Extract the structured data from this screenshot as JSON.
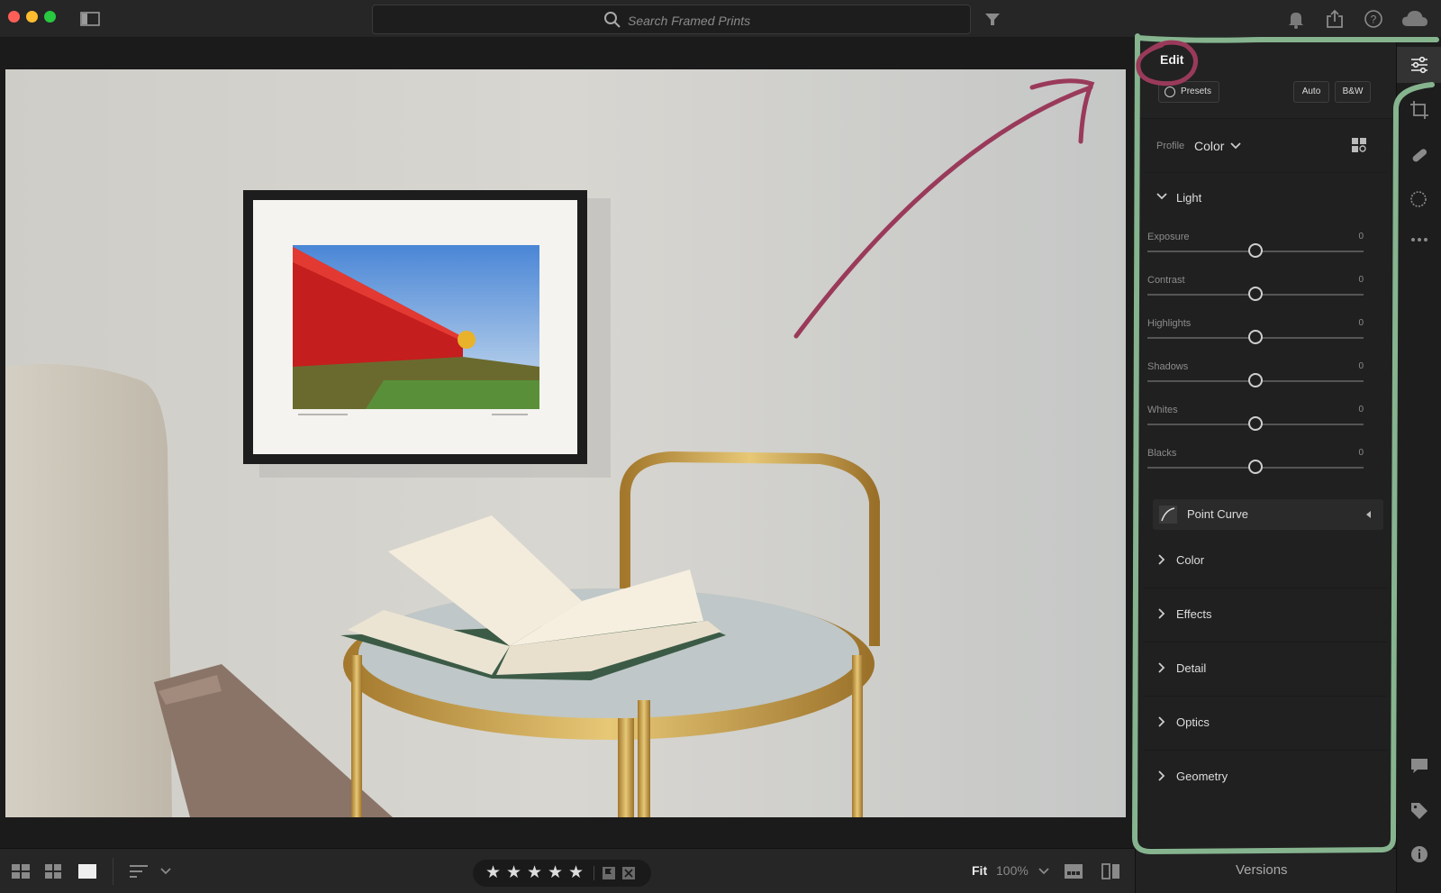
{
  "titlebar": {
    "search_placeholder": "Search Framed Prints",
    "icons": [
      "sidebar-toggle-icon",
      "search-icon",
      "filter-icon",
      "bell-icon",
      "share-icon",
      "help-icon",
      "cloud-icon"
    ]
  },
  "edit_panel": {
    "title": "Edit",
    "presets_label": "Presets",
    "auto_label": "Auto",
    "bw_label": "B&W",
    "profile_label": "Profile",
    "profile_value": "Color",
    "light_section": "Light",
    "sliders": [
      {
        "label": "Exposure",
        "value": "0"
      },
      {
        "label": "Contrast",
        "value": "0"
      },
      {
        "label": "Highlights",
        "value": "0"
      },
      {
        "label": "Shadows",
        "value": "0"
      },
      {
        "label": "Whites",
        "value": "0"
      },
      {
        "label": "Blacks",
        "value": "0"
      }
    ],
    "point_curve_label": "Point Curve",
    "sections": [
      "Color",
      "Effects",
      "Detail",
      "Optics",
      "Geometry"
    ]
  },
  "bottombar": {
    "rating_stars": 5,
    "zoom_fit": "Fit",
    "zoom_percent": "100%",
    "versions_label": "Versions"
  },
  "colors": {
    "annotation_circle": "#9a3a5a",
    "annotation_outline": "#86b48f",
    "panel_bg": "#202020"
  }
}
